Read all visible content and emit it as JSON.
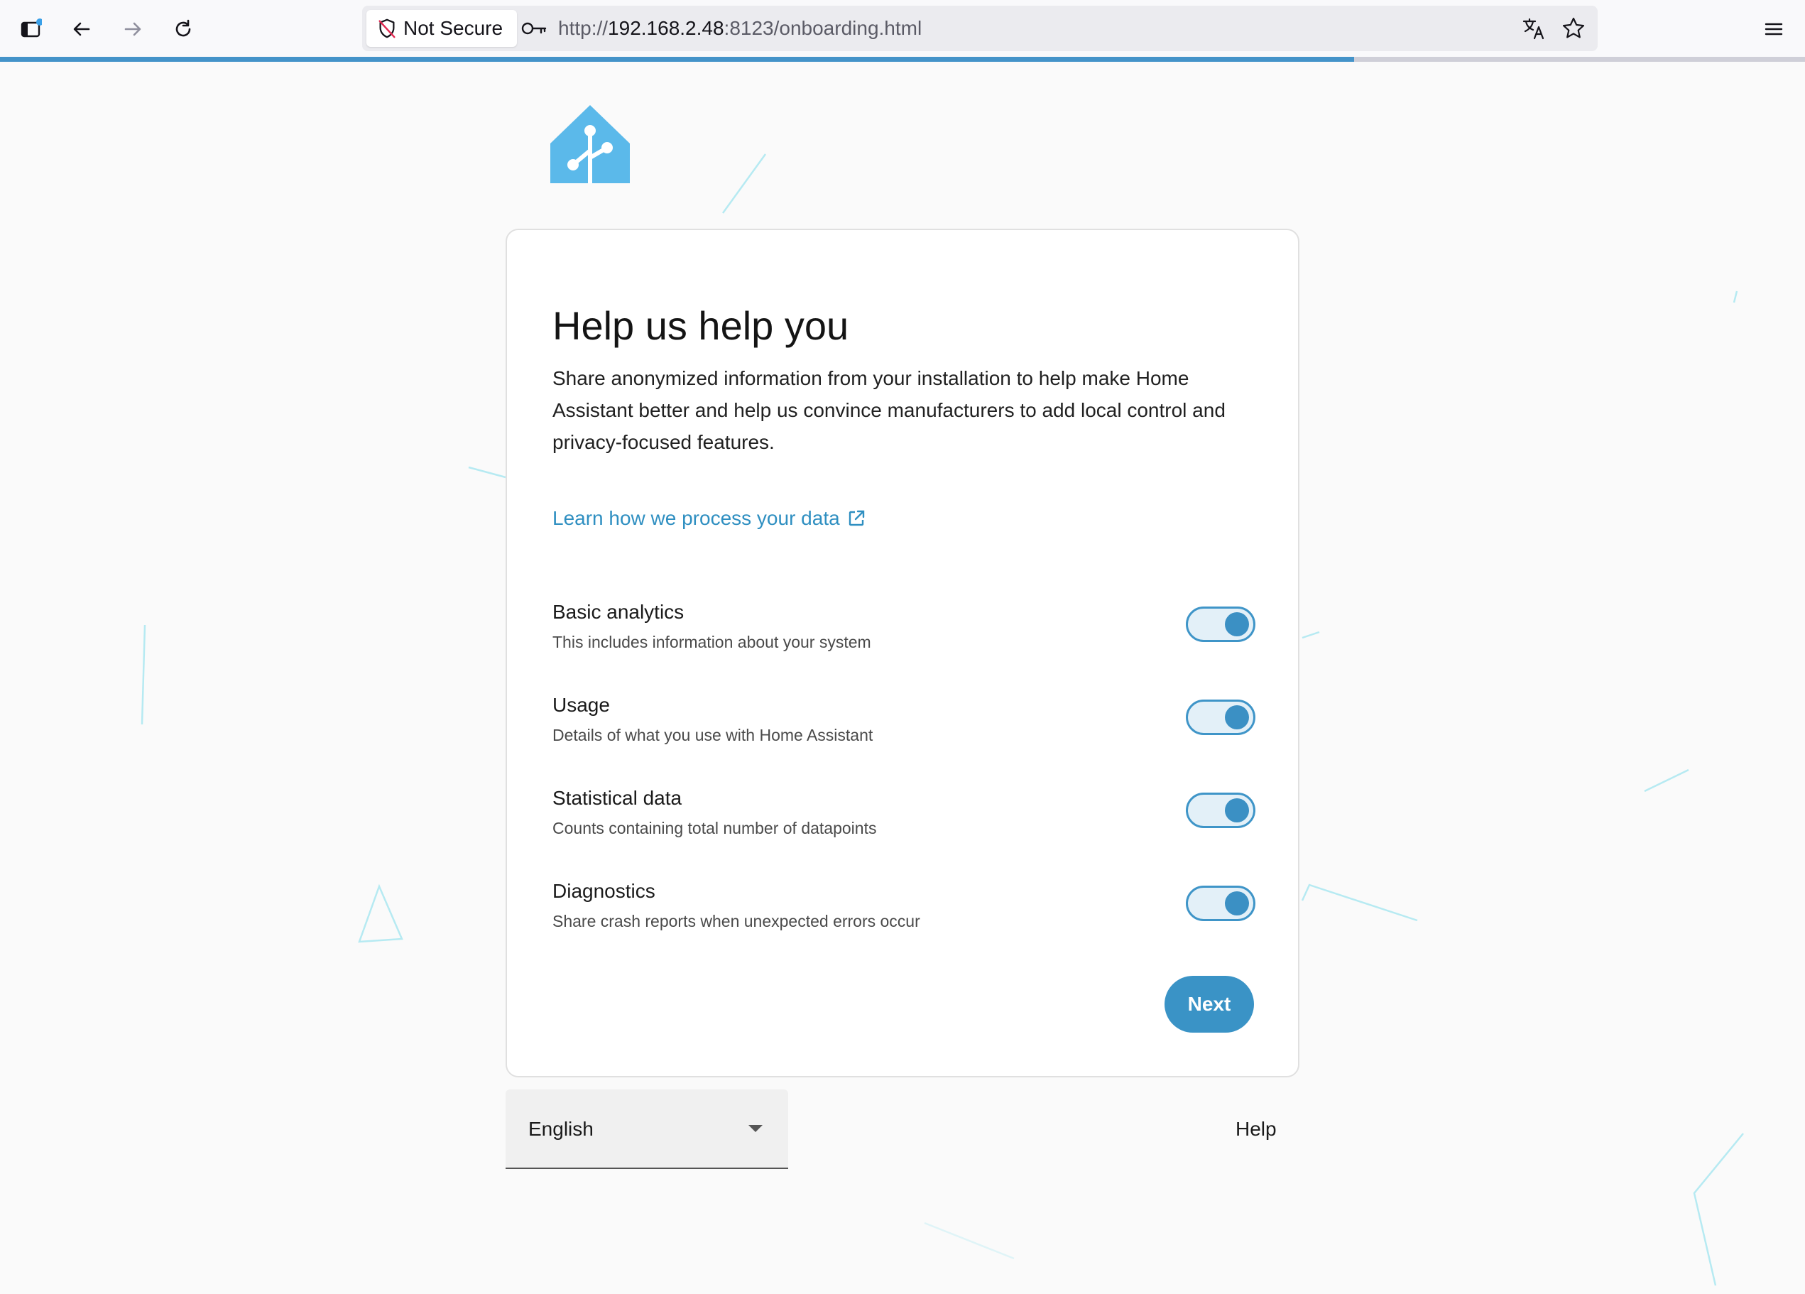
{
  "browser": {
    "security_label": "Not Secure",
    "url_prefix": "http://",
    "url_host": "192.168.2.48",
    "url_suffix": ":8123/onboarding.html",
    "load_progress": 0.75
  },
  "card": {
    "title": "Help us help you",
    "description": "Share anonymized information from your installation to help make Home Assistant better and help us convince manufacturers to add local control and privacy-focused features.",
    "learn_link": "Learn how we process your data",
    "options": [
      {
        "title": "Basic analytics",
        "subtitle": "This includes information about your system",
        "enabled": true
      },
      {
        "title": "Usage",
        "subtitle": "Details of what you use with Home Assistant",
        "enabled": true
      },
      {
        "title": "Statistical data",
        "subtitle": "Counts containing total number of datapoints",
        "enabled": true
      },
      {
        "title": "Diagnostics",
        "subtitle": "Share crash reports when unexpected errors occur",
        "enabled": true
      }
    ],
    "next_label": "Next"
  },
  "footer": {
    "language": "English",
    "help_label": "Help"
  },
  "colors": {
    "accent": "#3a93c6",
    "logo": "#5bb9ea"
  },
  "icons": [
    "sidebar-icon",
    "back-arrow-icon",
    "forward-arrow-icon",
    "reload-icon",
    "shield-slash-icon",
    "key-icon",
    "translate-icon",
    "star-icon",
    "menu-icon",
    "external-link-icon",
    "dropdown-arrow-icon"
  ]
}
